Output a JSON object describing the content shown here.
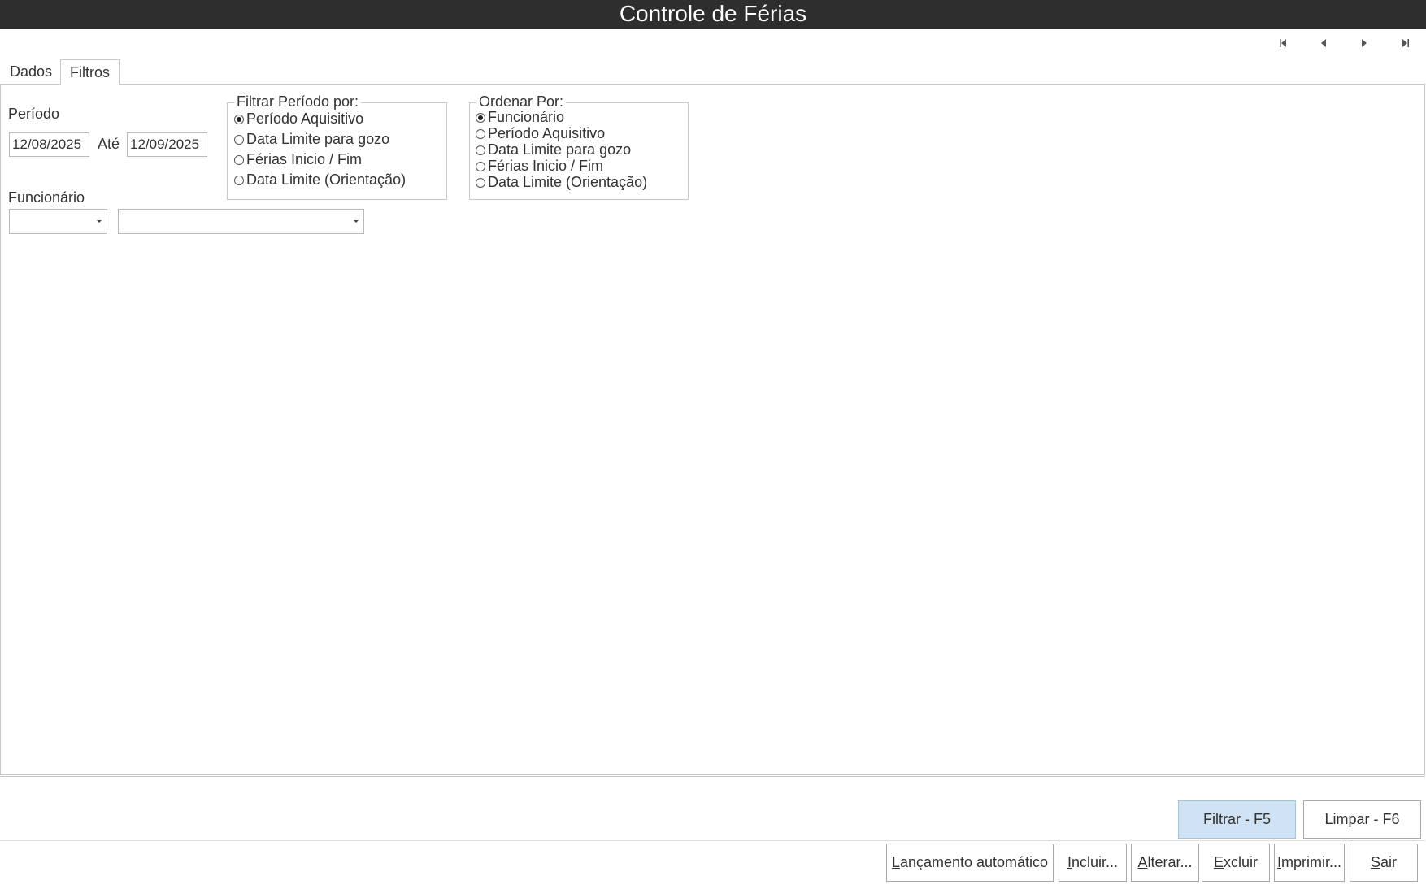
{
  "window": {
    "title": "Controle de Férias"
  },
  "nav": [
    "first-record",
    "previous-record",
    "next-record",
    "last-record"
  ],
  "tabs": [
    {
      "label": "Dados",
      "active": false
    },
    {
      "label": "Filtros",
      "active": true
    }
  ],
  "filters": {
    "period_label": "Período",
    "date_from": "12/08/2025",
    "until_label": "Até",
    "date_to": "12/09/2025",
    "employee_label": "Funcionário",
    "employee_code": "",
    "employee_name": "",
    "filter_by": {
      "legend": "Filtrar Período por:",
      "options": [
        {
          "label": "Período Aquisitivo",
          "checked": true
        },
        {
          "label": "Data Limite para gozo",
          "checked": false
        },
        {
          "label": "Férias Inicio / Fim",
          "checked": false
        },
        {
          "label": "Data Limite (Orientação)",
          "checked": false
        }
      ]
    },
    "order_by": {
      "legend": "Ordenar Por:",
      "options": [
        {
          "label": "Funcionário",
          "checked": true
        },
        {
          "label": "Período Aquisitivo",
          "checked": false
        },
        {
          "label": "Data Limite para gozo",
          "checked": false
        },
        {
          "label": "Férias Inicio / Fim",
          "checked": false
        },
        {
          "label": "Data Limite (Orientação)",
          "checked": false
        }
      ]
    }
  },
  "filter_buttons": {
    "filter": "Filtrar - F5",
    "clear": "Limpar - F6"
  },
  "actions": {
    "auto_launch": {
      "mnemonic": "L",
      "rest": "ançamento automático"
    },
    "include": {
      "mnemonic": "I",
      "rest": "ncluir..."
    },
    "edit": {
      "mnemonic": "A",
      "rest": "lterar..."
    },
    "delete": {
      "mnemonic": "E",
      "rest": "xcluir"
    },
    "print": {
      "mnemonic": "I",
      "rest": "mprimir..."
    },
    "exit": {
      "mnemonic": "S",
      "rest": "air"
    }
  },
  "colors": {
    "titlebar": "#2e2e2e",
    "primary_button": "#cfe3f4"
  }
}
